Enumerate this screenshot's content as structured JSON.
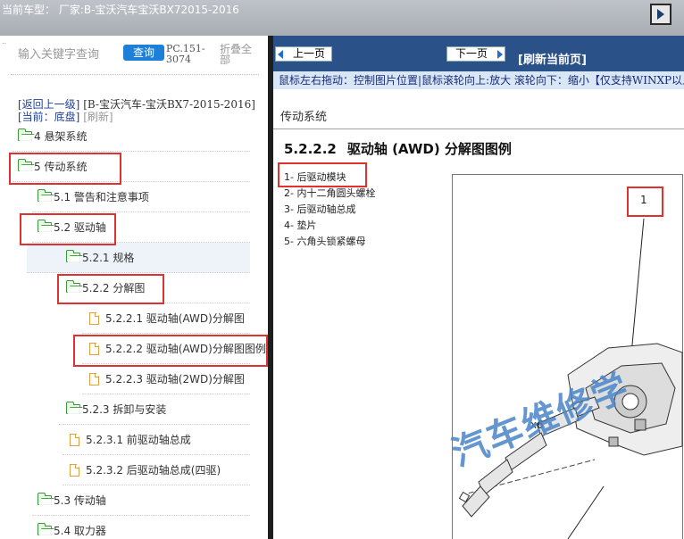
{
  "app": {
    "title": "当前车型：  厂家:B-宝沃汽车宝沃BX72015-2016"
  },
  "left_panel": {
    "search_placeholder": "输入关键字查询",
    "search_button": "查询",
    "code": "PC.151-3074",
    "collapse_all": "折叠全部",
    "back_link": "[返回上一级]",
    "path": "[B-宝沃汽车-宝沃BX7-2015-2016]",
    "current_label": "[当前：底盘]",
    "refresh_link": "[刷新]",
    "tree": [
      {
        "id": "n4",
        "label": "4 悬架系统",
        "icon": "folder-icon"
      },
      {
        "id": "n5",
        "label": "5 传动系统",
        "icon": "folder-icon"
      },
      {
        "id": "n51",
        "label": "5.1 警告和注意事项",
        "icon": "folder-icon"
      },
      {
        "id": "n52",
        "label": "5.2 驱动轴",
        "icon": "folder-icon"
      },
      {
        "id": "n521",
        "label": "5.2.1 规格",
        "icon": "folder-icon"
      },
      {
        "id": "n522",
        "label": "5.2.2 分解图",
        "icon": "folder-icon"
      },
      {
        "id": "n5221",
        "label": "5.2.2.1 驱动轴(AWD)分解图",
        "icon": "document-icon"
      },
      {
        "id": "n5222",
        "label": "5.2.2.2 驱动轴(AWD)分解图图例",
        "icon": "document-icon"
      },
      {
        "id": "n5223",
        "label": "5.2.2.3 驱动轴(2WD)分解图",
        "icon": "document-icon"
      },
      {
        "id": "n523",
        "label": "5.2.3 拆卸与安装",
        "icon": "folder-icon"
      },
      {
        "id": "n5231",
        "label": "5.2.3.1 前驱动轴总成",
        "icon": "document-icon"
      },
      {
        "id": "n5232",
        "label": "5.2.3.2 后驱动轴总成(四驱)",
        "icon": "document-icon"
      },
      {
        "id": "n53",
        "label": "5.3 传动轴",
        "icon": "folder-icon"
      },
      {
        "id": "n54",
        "label": "5.4 取力器",
        "icon": "folder-icon"
      }
    ]
  },
  "right_panel": {
    "prev_button": "上一页",
    "next_button": "下一页",
    "refresh_current": "[刷新当前页]",
    "hint": "鼠标左右拖动：控制图片位置|鼠标滚轮向上:放大  滚轮向下：缩小【仅支持WINXP以上",
    "section_title": "传动系统",
    "doc_number": "5.2.2.2",
    "doc_title": "驱动轴 (AWD) 分解图图例",
    "legend": [
      "1- 后驱动模块",
      "2- 内十二角圆头螺栓",
      "3- 后驱动轴总成",
      "4- 垫片",
      "5- 六角头锁紧螺母"
    ],
    "figure_callout": "1",
    "figure_qty": "x6",
    "watermark": "汽车维修学"
  },
  "colors": {
    "nav_bar": "#2a5188",
    "hint_bar": "#d9e6f5",
    "search_button": "#1e7fd8",
    "highlight_box": "#e03131",
    "folder": "#3a9a3a",
    "document": "#e0a040"
  }
}
